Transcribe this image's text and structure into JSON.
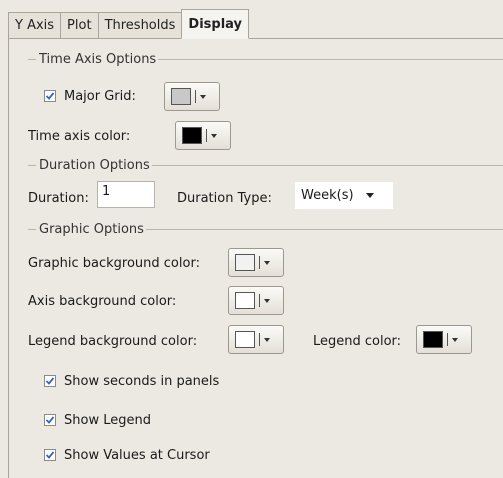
{
  "tabs": [
    "Y Axis",
    "Plot",
    "Thresholds",
    "Display"
  ],
  "active_tab": "Display",
  "time_axis": {
    "group_title": "Time Axis Options",
    "major_grid_label": "Major Grid:",
    "major_grid_checked": true,
    "major_grid_color": "#c8c8c8",
    "time_axis_color_label": "Time axis color:",
    "time_axis_color": "#000000"
  },
  "duration": {
    "group_title": "Duration Options",
    "duration_label": "Duration:",
    "duration_value": "1",
    "duration_type_label": "Duration Type:",
    "duration_type_value": "Week(s)"
  },
  "graphic": {
    "group_title": "Graphic Options",
    "graphic_bg_label": "Graphic background color:",
    "graphic_bg_color": "#f2f2f2",
    "axis_bg_label": "Axis background color:",
    "axis_bg_color": "#ffffff",
    "legend_bg_label": "Legend background color:",
    "legend_bg_color": "#ffffff",
    "legend_color_label": "Legend color:",
    "legend_color": "#000000",
    "show_seconds_label": "Show seconds in panels",
    "show_seconds_checked": true,
    "show_legend_label": "Show Legend",
    "show_legend_checked": true,
    "show_values_label": "Show Values at Cursor",
    "show_values_checked": true
  }
}
